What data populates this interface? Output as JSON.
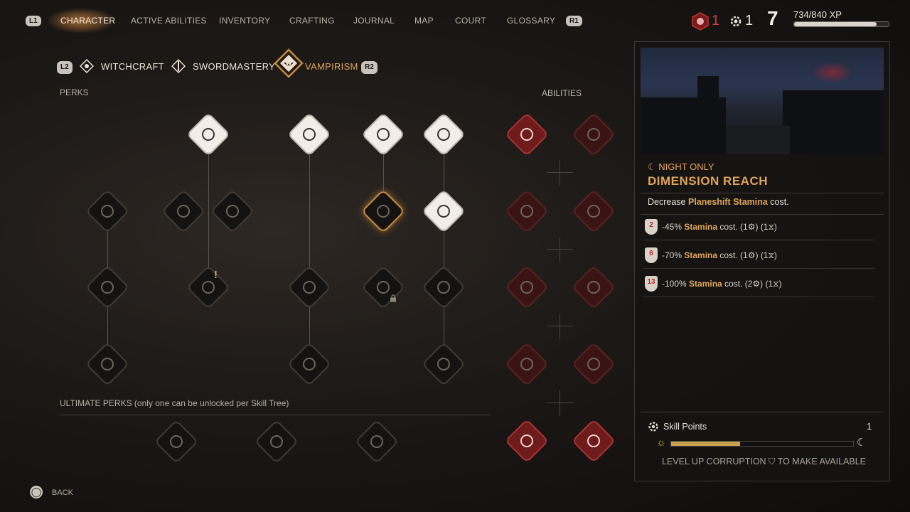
{
  "nav": {
    "left_button": "L1",
    "right_button": "R1",
    "tabs": [
      "CHARACTER",
      "ACTIVE ABILITIES",
      "INVENTORY",
      "CRAFTING",
      "JOURNAL",
      "MAP",
      "COURT",
      "GLOSSARY"
    ],
    "active_tab": "CHARACTER"
  },
  "header": {
    "corruption_points": "1",
    "skill_points": "1",
    "level": "7",
    "xp": "734/840 XP",
    "xp_progress": 0.874
  },
  "tree_tabs": {
    "left_button": "L2",
    "right_button": "R2",
    "items": [
      "WITCHCRAFT",
      "SWORDMASTERY",
      "VAMPIRISM"
    ],
    "active": "VAMPIRISM"
  },
  "labels": {
    "perks": "PERKS",
    "abilities": "ABILITIES",
    "ultimate": "ULTIMATE PERKS (only one can be unlocked per Skill Tree)"
  },
  "detail": {
    "condition": "☾ NIGHT ONLY",
    "title": "DIMENSION REACH",
    "desc_prefix": "Decrease ",
    "desc_highlight": "Planeshift Stamina",
    "desc_suffix": " cost.",
    "ranks": [
      {
        "required": "2",
        "prefix": "-45% ",
        "stat": "Stamina",
        "suffix": " cost.  (1⚙) (1⧖)"
      },
      {
        "required": "6",
        "prefix": "-70% ",
        "stat": "Stamina",
        "suffix": " cost.  (1⚙) (1⧖)"
      },
      {
        "required": "13",
        "prefix": "-100% ",
        "stat": "Stamina",
        "suffix": " cost.  (2⚙) (1⧖)"
      }
    ],
    "skill_points_label": "Skill Points",
    "skill_points_value": "1",
    "corruption_progress": 0.38,
    "level_up_note": "LEVEL UP CORRUPTION ⛉ TO MAKE AVAILABLE"
  },
  "footer": {
    "back_button": "◯",
    "back_label": "BACK"
  },
  "colors": {
    "accent": "#e0a55a",
    "corruption_red": "#b8242a",
    "text": "#d9d3c7"
  },
  "exclamation": "!"
}
